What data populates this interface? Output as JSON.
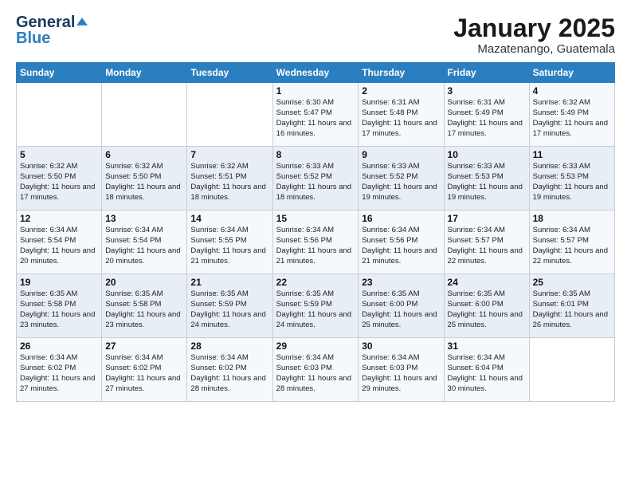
{
  "header": {
    "logo_general": "General",
    "logo_blue": "Blue",
    "title": "January 2025",
    "subtitle": "Mazatenango, Guatemala"
  },
  "calendar": {
    "days_of_week": [
      "Sunday",
      "Monday",
      "Tuesday",
      "Wednesday",
      "Thursday",
      "Friday",
      "Saturday"
    ],
    "weeks": [
      [
        {
          "day": "",
          "info": ""
        },
        {
          "day": "",
          "info": ""
        },
        {
          "day": "",
          "info": ""
        },
        {
          "day": "1",
          "info": "Sunrise: 6:30 AM\nSunset: 5:47 PM\nDaylight: 11 hours\nand 16 minutes."
        },
        {
          "day": "2",
          "info": "Sunrise: 6:31 AM\nSunset: 5:48 PM\nDaylight: 11 hours\nand 17 minutes."
        },
        {
          "day": "3",
          "info": "Sunrise: 6:31 AM\nSunset: 5:49 PM\nDaylight: 11 hours\nand 17 minutes."
        },
        {
          "day": "4",
          "info": "Sunrise: 6:32 AM\nSunset: 5:49 PM\nDaylight: 11 hours\nand 17 minutes."
        }
      ],
      [
        {
          "day": "5",
          "info": "Sunrise: 6:32 AM\nSunset: 5:50 PM\nDaylight: 11 hours\nand 17 minutes."
        },
        {
          "day": "6",
          "info": "Sunrise: 6:32 AM\nSunset: 5:50 PM\nDaylight: 11 hours\nand 18 minutes."
        },
        {
          "day": "7",
          "info": "Sunrise: 6:32 AM\nSunset: 5:51 PM\nDaylight: 11 hours\nand 18 minutes."
        },
        {
          "day": "8",
          "info": "Sunrise: 6:33 AM\nSunset: 5:52 PM\nDaylight: 11 hours\nand 18 minutes."
        },
        {
          "day": "9",
          "info": "Sunrise: 6:33 AM\nSunset: 5:52 PM\nDaylight: 11 hours\nand 19 minutes."
        },
        {
          "day": "10",
          "info": "Sunrise: 6:33 AM\nSunset: 5:53 PM\nDaylight: 11 hours\nand 19 minutes."
        },
        {
          "day": "11",
          "info": "Sunrise: 6:33 AM\nSunset: 5:53 PM\nDaylight: 11 hours\nand 19 minutes."
        }
      ],
      [
        {
          "day": "12",
          "info": "Sunrise: 6:34 AM\nSunset: 5:54 PM\nDaylight: 11 hours\nand 20 minutes."
        },
        {
          "day": "13",
          "info": "Sunrise: 6:34 AM\nSunset: 5:54 PM\nDaylight: 11 hours\nand 20 minutes."
        },
        {
          "day": "14",
          "info": "Sunrise: 6:34 AM\nSunset: 5:55 PM\nDaylight: 11 hours\nand 21 minutes."
        },
        {
          "day": "15",
          "info": "Sunrise: 6:34 AM\nSunset: 5:56 PM\nDaylight: 11 hours\nand 21 minutes."
        },
        {
          "day": "16",
          "info": "Sunrise: 6:34 AM\nSunset: 5:56 PM\nDaylight: 11 hours\nand 21 minutes."
        },
        {
          "day": "17",
          "info": "Sunrise: 6:34 AM\nSunset: 5:57 PM\nDaylight: 11 hours\nand 22 minutes."
        },
        {
          "day": "18",
          "info": "Sunrise: 6:34 AM\nSunset: 5:57 PM\nDaylight: 11 hours\nand 22 minutes."
        }
      ],
      [
        {
          "day": "19",
          "info": "Sunrise: 6:35 AM\nSunset: 5:58 PM\nDaylight: 11 hours\nand 23 minutes."
        },
        {
          "day": "20",
          "info": "Sunrise: 6:35 AM\nSunset: 5:58 PM\nDaylight: 11 hours\nand 23 minutes."
        },
        {
          "day": "21",
          "info": "Sunrise: 6:35 AM\nSunset: 5:59 PM\nDaylight: 11 hours\nand 24 minutes."
        },
        {
          "day": "22",
          "info": "Sunrise: 6:35 AM\nSunset: 5:59 PM\nDaylight: 11 hours\nand 24 minutes."
        },
        {
          "day": "23",
          "info": "Sunrise: 6:35 AM\nSunset: 6:00 PM\nDaylight: 11 hours\nand 25 minutes."
        },
        {
          "day": "24",
          "info": "Sunrise: 6:35 AM\nSunset: 6:00 PM\nDaylight: 11 hours\nand 25 minutes."
        },
        {
          "day": "25",
          "info": "Sunrise: 6:35 AM\nSunset: 6:01 PM\nDaylight: 11 hours\nand 26 minutes."
        }
      ],
      [
        {
          "day": "26",
          "info": "Sunrise: 6:34 AM\nSunset: 6:02 PM\nDaylight: 11 hours\nand 27 minutes."
        },
        {
          "day": "27",
          "info": "Sunrise: 6:34 AM\nSunset: 6:02 PM\nDaylight: 11 hours\nand 27 minutes."
        },
        {
          "day": "28",
          "info": "Sunrise: 6:34 AM\nSunset: 6:02 PM\nDaylight: 11 hours\nand 28 minutes."
        },
        {
          "day": "29",
          "info": "Sunrise: 6:34 AM\nSunset: 6:03 PM\nDaylight: 11 hours\nand 28 minutes."
        },
        {
          "day": "30",
          "info": "Sunrise: 6:34 AM\nSunset: 6:03 PM\nDaylight: 11 hours\nand 29 minutes."
        },
        {
          "day": "31",
          "info": "Sunrise: 6:34 AM\nSunset: 6:04 PM\nDaylight: 11 hours\nand 30 minutes."
        },
        {
          "day": "",
          "info": ""
        }
      ]
    ]
  }
}
